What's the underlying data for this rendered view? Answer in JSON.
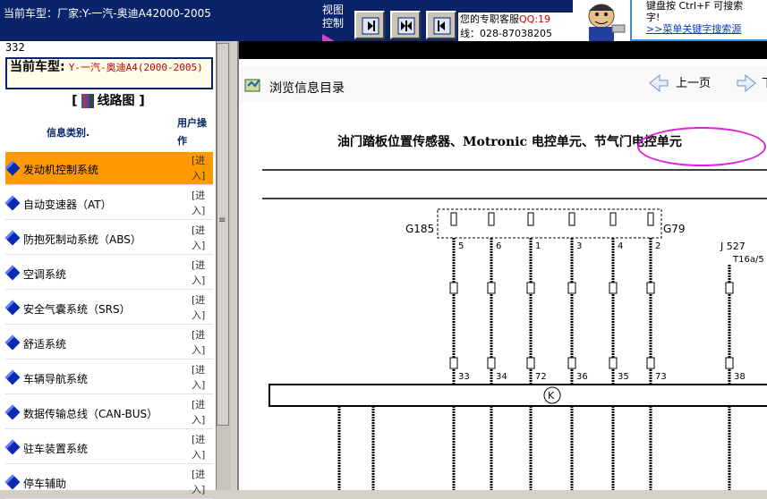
{
  "window": {
    "title": "当前车型：厂家:Y-一汽-奥迪A42000-2005",
    "view_control_label": "视图控制",
    "service_text": "您的专职客服",
    "service_qq": "QQ:19",
    "service_phone": "线：028-87038205",
    "search_hint_line1": "键盘按  Ctrl+F  可搜索",
    "search_hint_line2": "字!",
    "search_hint_link": ">>菜单关键字搜索源"
  },
  "left": {
    "count": "332",
    "model_label": "当前车型:",
    "model_value": "Y-一汽-奥迪A4(2000-2005)",
    "section_title": "线路图",
    "col_category": "信息类别.",
    "col_action": "用户操作",
    "action_label": "[进入]",
    "items": [
      {
        "name": "发动机控制系统",
        "selected": true
      },
      {
        "name": "自动变速器（AT）",
        "selected": false
      },
      {
        "name": "防抱死制动系统（ABS）",
        "selected": false
      },
      {
        "name": "空调系统",
        "selected": false
      },
      {
        "name": "安全气囊系统（SRS）",
        "selected": false
      },
      {
        "name": "舒适系统",
        "selected": false
      },
      {
        "name": "车辆导航系统",
        "selected": false
      },
      {
        "name": "数据传输总线（CAN-BUS）",
        "selected": false
      },
      {
        "name": "驻车装置系统",
        "selected": false
      },
      {
        "name": "停车辅助",
        "selected": false
      }
    ]
  },
  "right": {
    "browse_label": "浏览信息目录",
    "prev_label": "上一页",
    "next_label": "下",
    "diagram_title": "油门踏板位置传感器、Motronic 电控单元、节气门电控单元"
  },
  "colors": {
    "titlebar": "#0a246a",
    "selected_row": "#ff9900",
    "highlight_circle": "#e020e0",
    "qq": "#d00000"
  }
}
